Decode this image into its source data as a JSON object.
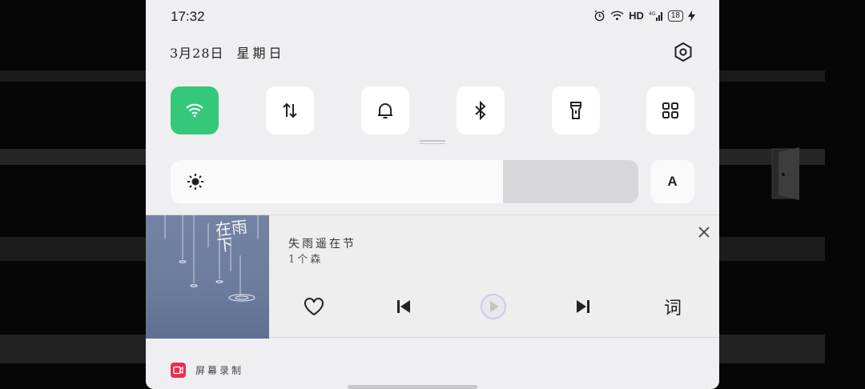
{
  "status_bar": {
    "time": "17:32",
    "network_label": "HD",
    "cellular_label": "4G",
    "battery_level": "18",
    "icons": [
      "alarm-icon",
      "wifi-signal-icon",
      "cellular-signal-icon",
      "battery-icon",
      "charging-icon"
    ]
  },
  "header": {
    "date": "3月28日",
    "weekday": "星期日",
    "settings_icon": "gear-icon"
  },
  "quick_toggles": [
    {
      "name": "wifi",
      "icon": "wifi-icon",
      "active": true
    },
    {
      "name": "mobile-data",
      "icon": "data-arrows-icon",
      "active": false
    },
    {
      "name": "sound",
      "icon": "bell-icon",
      "active": false
    },
    {
      "name": "bluetooth",
      "icon": "bluetooth-icon",
      "active": false
    },
    {
      "name": "flashlight",
      "icon": "flashlight-icon",
      "active": false
    },
    {
      "name": "more",
      "icon": "grid-icon",
      "active": false
    }
  ],
  "brightness": {
    "level": 0.71,
    "auto_label": "A"
  },
  "media": {
    "song_title": "失雨遥在节",
    "artist": "1个森",
    "album_art_text": "在雨下",
    "controls": [
      "heart-icon",
      "previous-icon",
      "play-icon",
      "next-icon"
    ],
    "lyrics_label": "词"
  },
  "notification": {
    "label": "屏幕录制"
  },
  "colors": {
    "accent": "#35c87b",
    "panel_bg": "#efeff1",
    "record_red": "#e8304f"
  }
}
